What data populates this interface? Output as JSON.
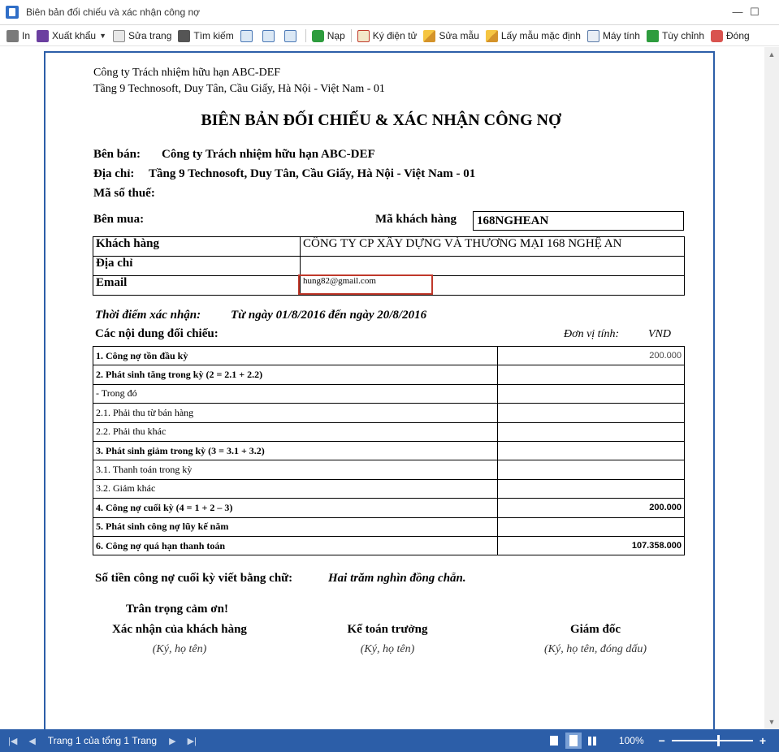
{
  "window": {
    "title": "Biên bản đối chiếu và xác nhận công nợ"
  },
  "toolbar": {
    "print": "In",
    "export": "Xuất khẩu",
    "edit_page": "Sửa trang",
    "search": "Tìm kiếm",
    "refresh": "Nạp",
    "e_sign": "Ký điện tử",
    "edit_template": "Sửa mẫu",
    "default_template": "Lấy mẫu mặc định",
    "calculator": "Máy tính",
    "customize": "Tùy chỉnh",
    "close": "Đóng"
  },
  "doc": {
    "company_name": "Công ty Trách nhiệm hữu hạn ABC-DEF",
    "company_address": "Tầng 9 Technosoft, Duy Tân, Cầu Giấy, Hà Nội - Việt Nam - 01",
    "title": "BIÊN BẢN ĐỐI CHIẾU & XÁC NHẬN CÔNG NỢ",
    "seller_label": "Bên bán:",
    "seller_value": "Công ty Trách nhiệm hữu hạn ABC-DEF",
    "address_label": "Địa chỉ:",
    "address_value": "Tầng 9 Technosoft, Duy Tân, Cầu Giấy, Hà Nội - Việt Nam - 01",
    "tax_label": "Mã số thuế:",
    "buyer_label": "Bên mua:",
    "customer_code_label": "Mã khách hàng",
    "customer_code_value": "168NGHEAN",
    "customer": {
      "name_label": "Khách hàng",
      "name_value": "CÔNG TY CP XÂY DỰNG VÀ THƯƠNG MẠI 168 NGHỆ AN",
      "address_label": "Địa chỉ",
      "address_value": "",
      "email_label": "Email",
      "email_value": "hung82@gmail.com"
    },
    "period_label": "Thời điểm xác nhận:",
    "period_value": "Từ ngày 01/8/2016 đến ngày 20/8/2016",
    "contents_label": "Các nội dung đối chiếu:",
    "currency_label": "Đơn vị tính:",
    "currency_value": "VND",
    "rows": [
      {
        "label": "1. Công nợ tồn đầu kỳ",
        "value": "200.000",
        "bold": true,
        "value_bold": false
      },
      {
        "label": "2. Phát sinh tăng trong kỳ (2 = 2.1 + 2.2)",
        "value": "",
        "bold": true,
        "value_bold": false
      },
      {
        "label": "- Trong đó",
        "value": "",
        "bold": false,
        "value_bold": false
      },
      {
        "label": "2.1. Phải thu từ bán hàng",
        "value": "",
        "bold": false,
        "value_bold": false
      },
      {
        "label": "2.2. Phải thu khác",
        "value": "",
        "bold": false,
        "value_bold": false
      },
      {
        "label": "3. Phát sinh giảm  trong kỳ (3 = 3.1 + 3.2)",
        "value": "",
        "bold": true,
        "value_bold": false
      },
      {
        "label": "3.1. Thanh toán trong kỳ",
        "value": "",
        "bold": false,
        "value_bold": false
      },
      {
        "label": "3.2. Giảm khác",
        "value": "",
        "bold": false,
        "value_bold": false
      },
      {
        "label": "4. Công nợ cuối kỳ (4 = 1 + 2 – 3)",
        "value": "200.000",
        "bold": true,
        "value_bold": true
      },
      {
        "label": "5. Phát sinh công nợ lũy kế năm",
        "value": "",
        "bold": true,
        "value_bold": false
      },
      {
        "label": "6. Công nợ quá hạn thanh toán",
        "value": "107.358.000",
        "bold": true,
        "value_bold": true
      }
    ],
    "words_label": "Số tiền công nợ cuối kỳ viết bằng chữ:",
    "words_value": "Hai trăm nghìn đồng chẵn.",
    "thanks": "Trân trọng cảm ơn!",
    "sign_customer": "Xác nhận của khách hàng",
    "sign_customer_sub": "(Ký, họ tên)",
    "sign_accountant": "Kế toán trưởng",
    "sign_accountant_sub": "(Ký, họ tên)",
    "sign_director": "Giám đốc",
    "sign_director_sub": "(Ký, họ tên, đóng dấu)"
  },
  "statusbar": {
    "page_info": "Trang 1 của tổng 1 Trang",
    "zoom": "100%"
  }
}
